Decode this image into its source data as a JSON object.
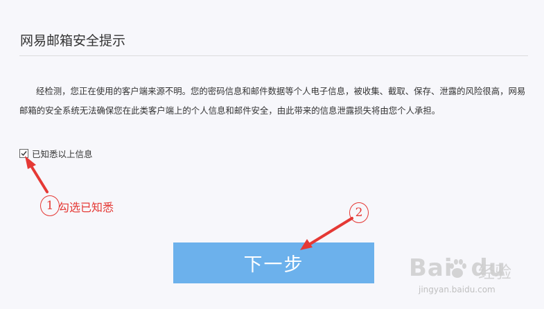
{
  "dialog": {
    "title": "网易邮箱安全提示",
    "message": "经检测，您正在使用的客户端来源不明。您的密码信息和邮件数据等个人电子信息，被收集、截取、保存、泄露的风险很高，网易邮箱的安全系统无法确保您在此类客户端上的个人信息和邮件安全，由此带来的信息泄露损失将由您个人承担。",
    "ack_label": "已知悉以上信息",
    "ack_checked": true,
    "next_button": "下一步"
  },
  "annotations": {
    "step1_number": "1",
    "step1_text": "勾选已知悉",
    "step2_number": "2",
    "color": "#e53935"
  },
  "watermark": {
    "logo": "Bai",
    "logo_suffix": "du",
    "brand_cn": "经验",
    "url": "jingyan.baidu.com"
  },
  "colors": {
    "button": "#6cb1ec",
    "background": "#f7f7fb"
  }
}
